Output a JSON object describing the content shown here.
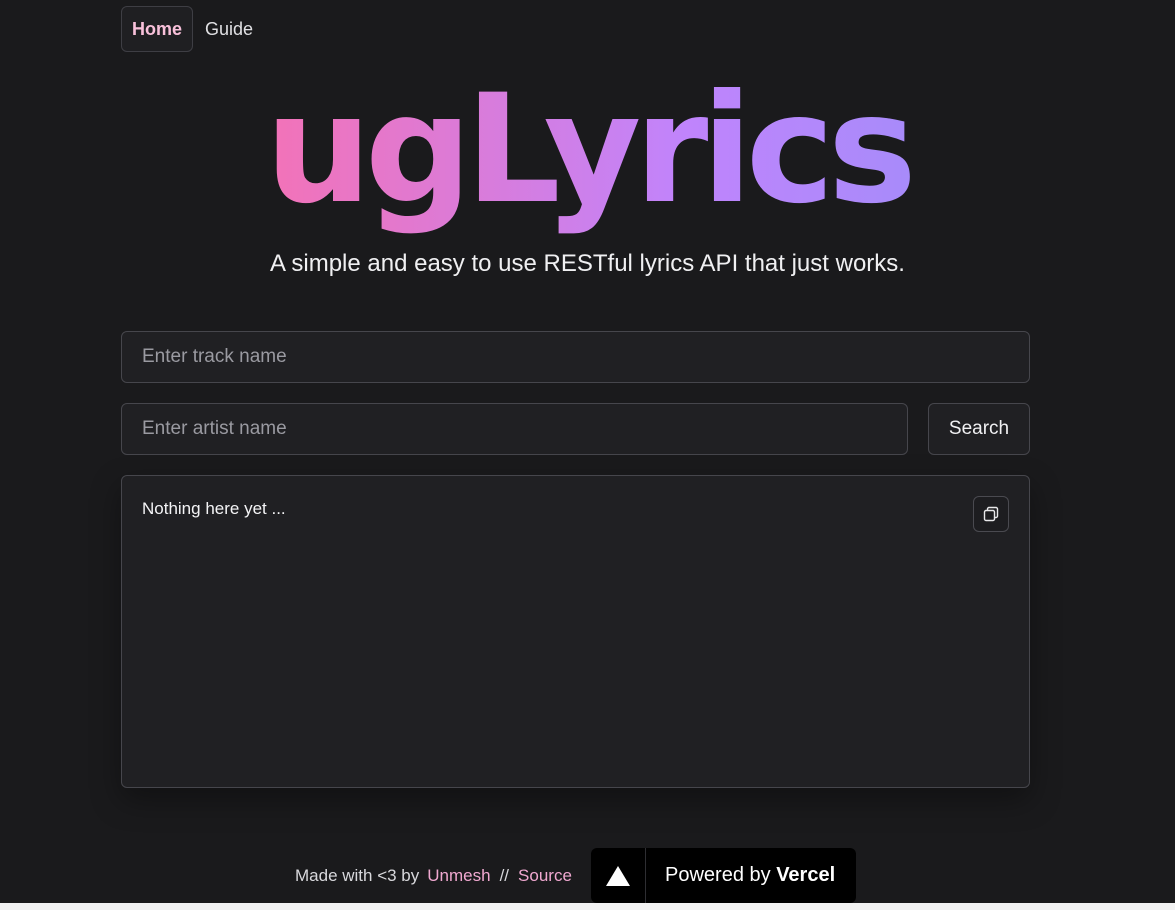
{
  "nav": {
    "items": [
      {
        "label": "Home",
        "active": true
      },
      {
        "label": "Guide",
        "active": false
      }
    ]
  },
  "hero": {
    "logo_text": "ugLyrics",
    "tagline": "A simple and easy to use RESTful lyrics API that just works."
  },
  "form": {
    "track_placeholder": "Enter track name",
    "track_value": "",
    "artist_placeholder": "Enter artist name",
    "artist_value": "",
    "search_label": "Search"
  },
  "output": {
    "text": "Nothing here yet ...",
    "copy_icon": "copy-icon"
  },
  "footer": {
    "made_with": "Made with <3 by",
    "author": "Unmesh",
    "separator": "//",
    "source": "Source",
    "badge_prefix": "Powered by",
    "badge_brand": "Vercel",
    "badge_icon": "vercel-triangle-icon"
  },
  "colors": {
    "background": "#1a1a1c",
    "gradient_start": "#f472b6",
    "gradient_end": "#a78bfa",
    "link": "#f0a8d0"
  }
}
